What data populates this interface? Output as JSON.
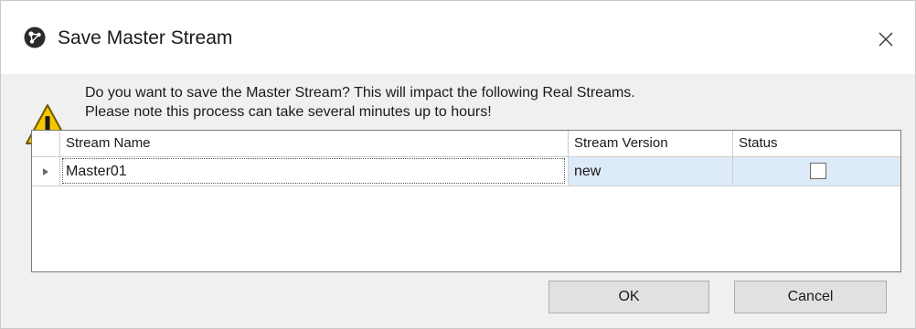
{
  "window": {
    "title": "Save Master Stream",
    "icon": "app-network-icon",
    "close_icon": "close-icon"
  },
  "message": {
    "icon": "warning-icon",
    "line1": "Do you want to save the Master Stream? This will impact the following Real Streams.",
    "line2": "Please note this process can take several minutes up to hours!"
  },
  "grid": {
    "columns": [
      "Stream Name",
      "Stream Version",
      "Status"
    ],
    "rows": [
      {
        "stream_name": "Master01",
        "stream_version": "new",
        "status_checked": false
      }
    ],
    "selected_row_color": "#ddeaf7"
  },
  "buttons": {
    "ok_label": "OK",
    "cancel_label": "Cancel"
  }
}
